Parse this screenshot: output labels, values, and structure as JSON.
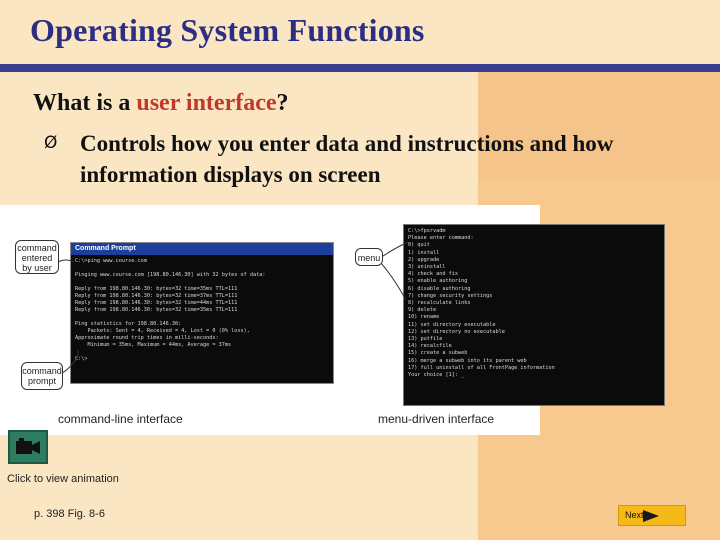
{
  "slide": {
    "title": "Operating System Functions",
    "question_prefix": "What is a ",
    "question_highlight": "user interface",
    "question_suffix": "?",
    "bullet_marker": "Ø",
    "bullet_text": "Controls how you enter data and instructions and how information displays on screen"
  },
  "figure": {
    "cmd_window_title": "Command Prompt",
    "cmd_lines": [
      "C:\\>ping www.course.com",
      "",
      "Pinging www.course.com [198.80.146.30] with 32 bytes of data:",
      "",
      "Reply from 198.80.146.30: bytes=32 time=35ms TTL=111",
      "Reply from 198.80.146.30: bytes=32 time=37ms TTL=111",
      "Reply from 198.80.146.30: bytes=32 time=44ms TTL=111",
      "Reply from 198.80.146.30: bytes=32 time=35ms TTL=111",
      "",
      "Ping statistics for 198.80.146.30:",
      "    Packets: Sent = 4, Received = 4, Lost = 0 (0% loss),",
      "Approximate round trip times in milli-seconds:",
      "    Minimum = 35ms, Maximum = 44ms, Average = 37ms",
      "",
      "C:\\>"
    ],
    "menu_lines": [
      "C:\\>fpsrvadm",
      "Please enter command:",
      "0) quit",
      "1) install",
      "2) upgrade",
      "3) uninstall",
      "4) check and fix",
      "5) enable authoring",
      "6) disable authoring",
      "7) change security settings",
      "8) recalculate links",
      "9) delete",
      "10) rename",
      "11) set directory executable",
      "12) set directory no executable",
      "13) putfile",
      "14) recalcfile",
      "15) create a subweb",
      "16) merge a subweb into its parent web",
      "17) full uninstall of all FrontPage information",
      "Your choice [1]: _"
    ],
    "callout_command_entered": "command entered by user",
    "callout_command_prompt": "command prompt",
    "callout_menu": "menu",
    "caption_cmd": "command-line interface",
    "caption_menu": "menu-driven interface"
  },
  "footer": {
    "animation_label": "Click to view animation",
    "page_ref": "p. 398 Fig. 8-6",
    "next_label": "Next"
  },
  "colors": {
    "title": "#2b2e83",
    "highlight": "#c0392b",
    "background": "#fbe6c3",
    "accent_column": "#f7c98e",
    "rule": "#3a3d8f",
    "next_button": "#f5b91a"
  }
}
